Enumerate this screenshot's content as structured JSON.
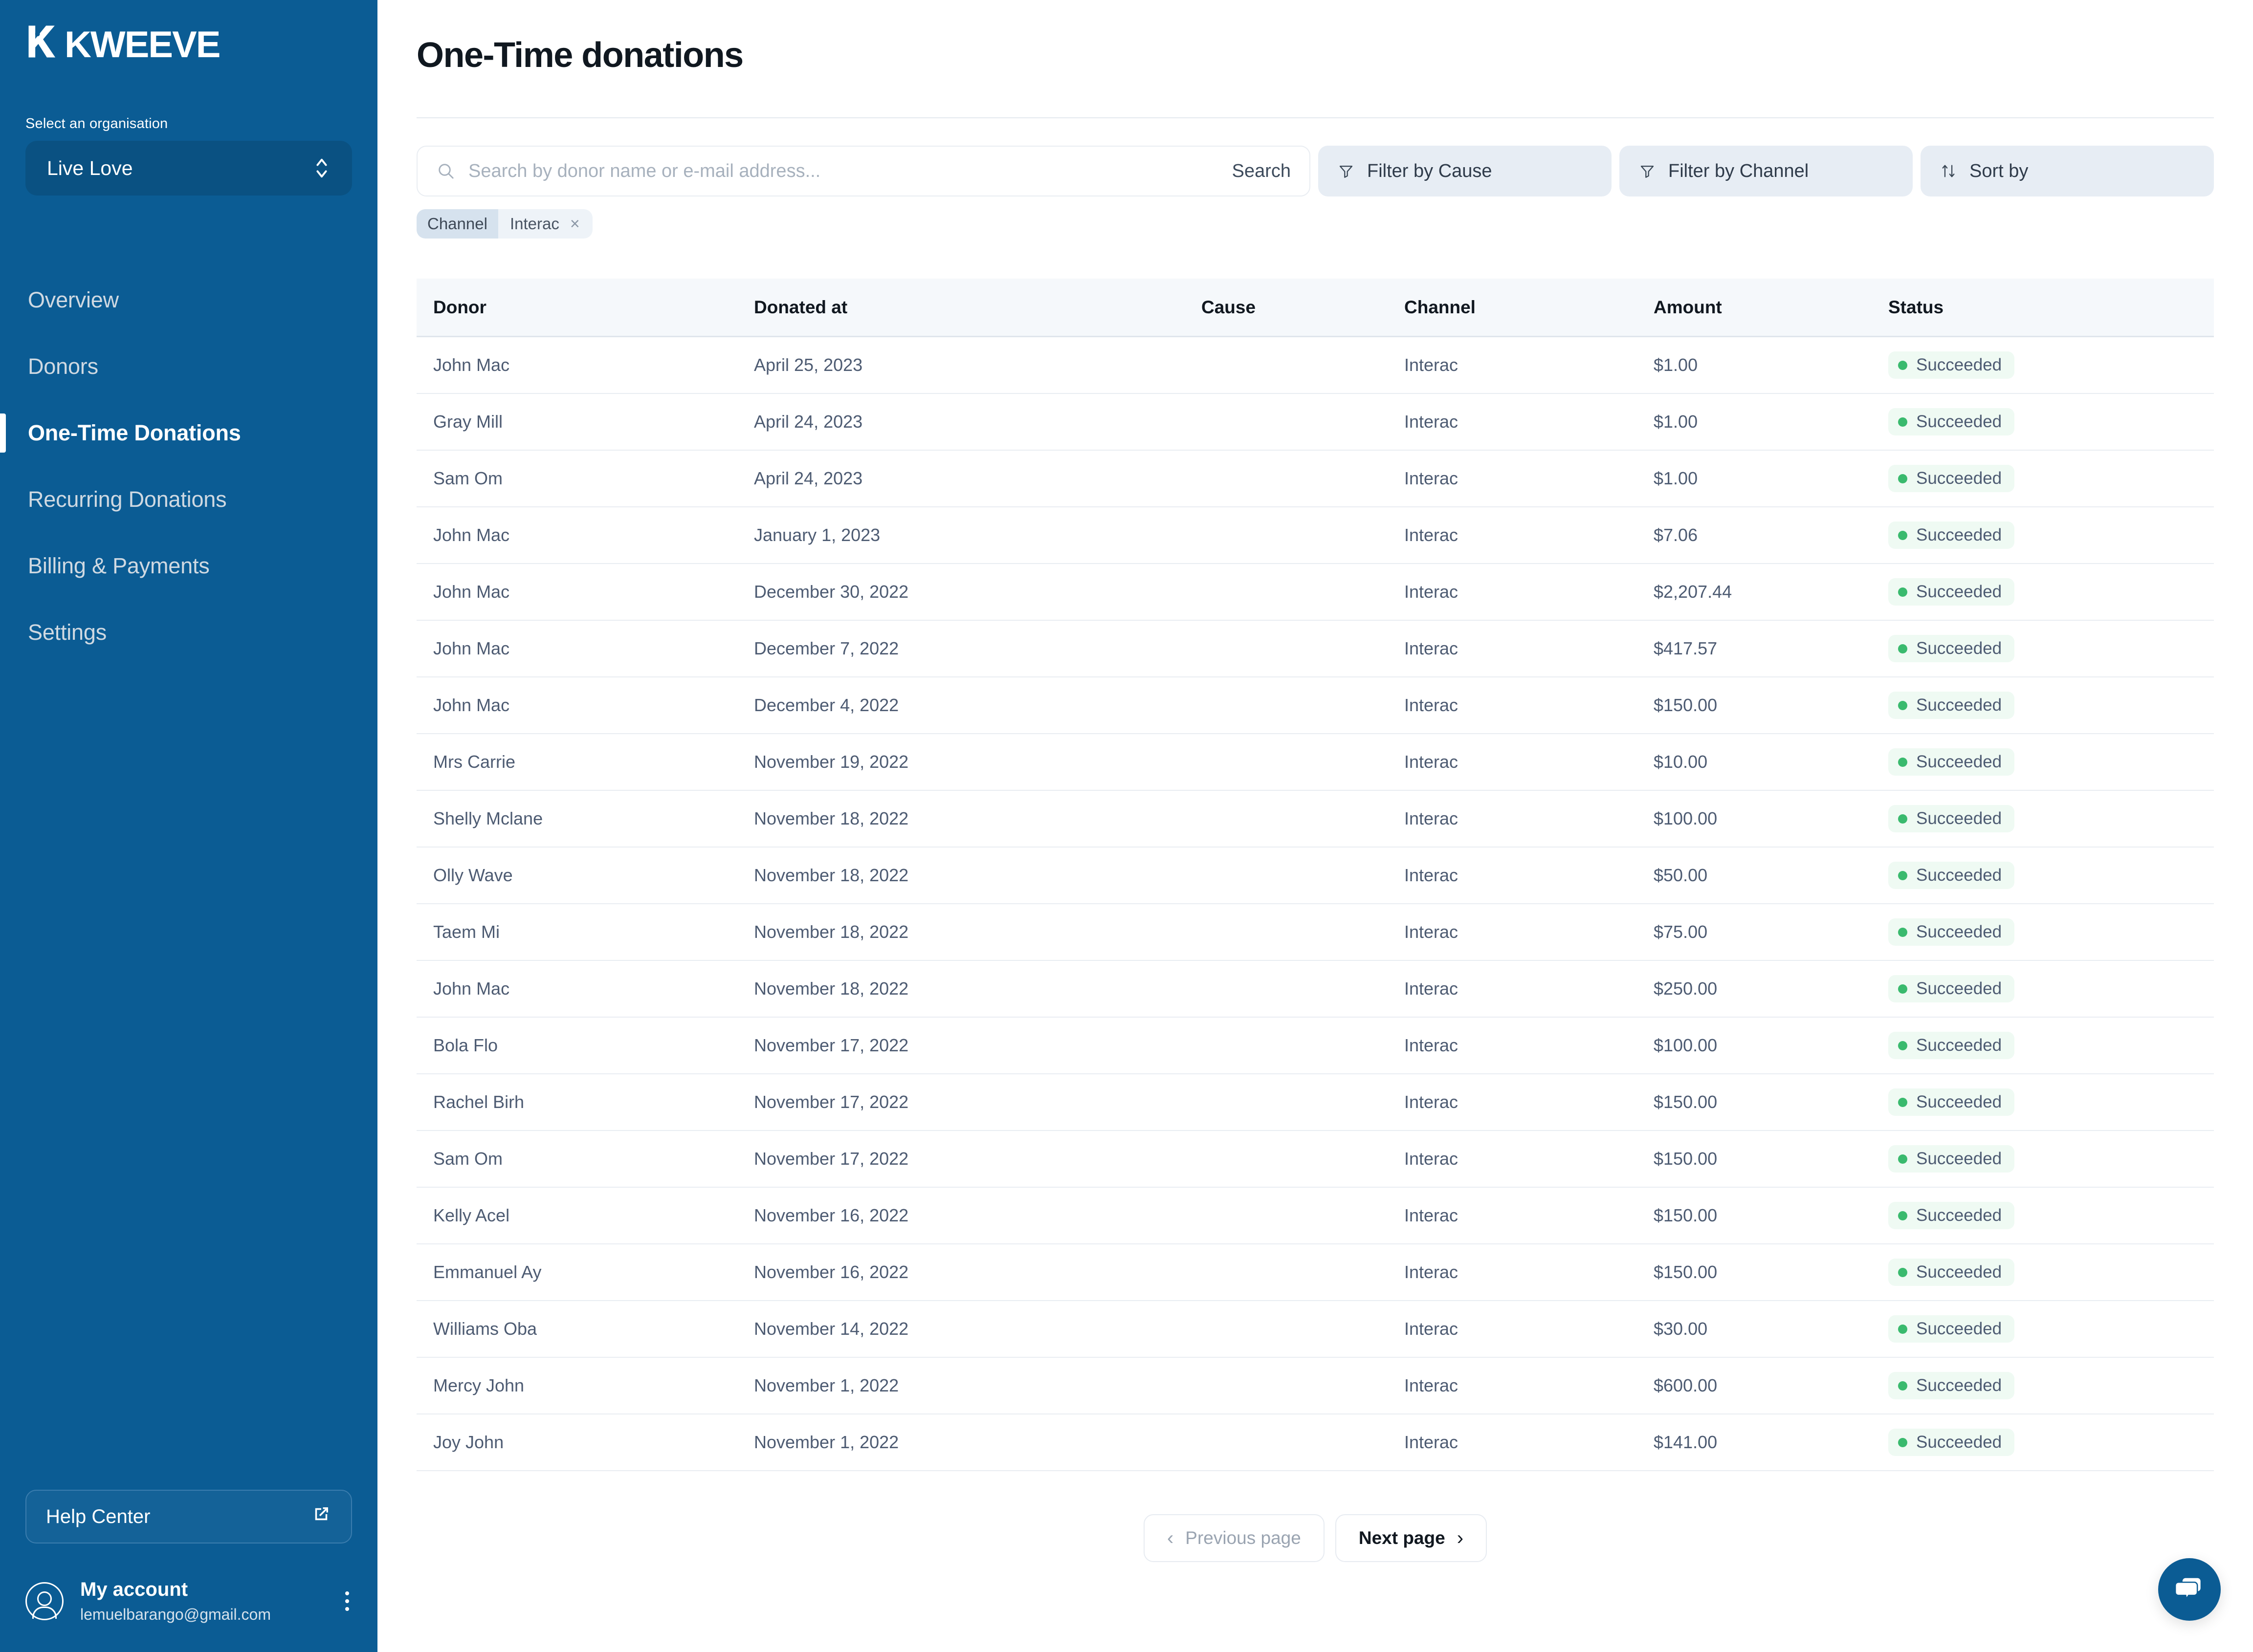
{
  "sidebar": {
    "logo": "KWEEVE",
    "org_label": "Select an organisation",
    "org_value": "Live Love",
    "nav": [
      {
        "label": "Overview"
      },
      {
        "label": "Donors"
      },
      {
        "label": "One-Time Donations"
      },
      {
        "label": "Recurring Donations"
      },
      {
        "label": "Billing & Payments"
      },
      {
        "label": "Settings"
      }
    ],
    "help_center": "Help Center",
    "account_name": "My account",
    "account_email": "lemuelbarango@gmail.com"
  },
  "header": {
    "title": "One-Time donations"
  },
  "toolbar": {
    "search_placeholder": "Search by donor name or e-mail address...",
    "search_value": "",
    "search_button": "Search",
    "filter_cause": "Filter by Cause",
    "filter_channel": "Filter by Channel",
    "sort_by": "Sort by"
  },
  "chips": [
    {
      "key": "Channel",
      "value": "Interac",
      "remove": "×"
    }
  ],
  "table": {
    "columns": [
      "Donor",
      "Donated at",
      "Cause",
      "Channel",
      "Amount",
      "Status"
    ],
    "rows": [
      {
        "donor": "John Mac",
        "date": "April 25, 2023",
        "cause": "",
        "channel": "Interac",
        "amount": "$1.00",
        "status": "Succeeded"
      },
      {
        "donor": "Gray Mill",
        "date": "April 24, 2023",
        "cause": "",
        "channel": "Interac",
        "amount": "$1.00",
        "status": "Succeeded"
      },
      {
        "donor": "Sam Om",
        "date": "April 24, 2023",
        "cause": "",
        "channel": "Interac",
        "amount": "$1.00",
        "status": "Succeeded"
      },
      {
        "donor": "John Mac",
        "date": "January 1, 2023",
        "cause": "",
        "channel": "Interac",
        "amount": "$7.06",
        "status": "Succeeded"
      },
      {
        "donor": "John Mac",
        "date": "December 30, 2022",
        "cause": "",
        "channel": "Interac",
        "amount": "$2,207.44",
        "status": "Succeeded"
      },
      {
        "donor": "John Mac",
        "date": "December 7, 2022",
        "cause": "",
        "channel": "Interac",
        "amount": "$417.57",
        "status": "Succeeded"
      },
      {
        "donor": "John Mac",
        "date": "December 4, 2022",
        "cause": "",
        "channel": "Interac",
        "amount": "$150.00",
        "status": "Succeeded"
      },
      {
        "donor": "Mrs Carrie",
        "date": "November 19, 2022",
        "cause": "",
        "channel": "Interac",
        "amount": "$10.00",
        "status": "Succeeded"
      },
      {
        "donor": "Shelly Mclane",
        "date": "November 18, 2022",
        "cause": "",
        "channel": "Interac",
        "amount": "$100.00",
        "status": "Succeeded"
      },
      {
        "donor": "Olly Wave",
        "date": "November 18, 2022",
        "cause": "",
        "channel": "Interac",
        "amount": "$50.00",
        "status": "Succeeded"
      },
      {
        "donor": "Taem Mi",
        "date": "November 18, 2022",
        "cause": "",
        "channel": "Interac",
        "amount": "$75.00",
        "status": "Succeeded"
      },
      {
        "donor": "John Mac",
        "date": "November 18, 2022",
        "cause": "",
        "channel": "Interac",
        "amount": "$250.00",
        "status": "Succeeded"
      },
      {
        "donor": "Bola Flo",
        "date": "November 17, 2022",
        "cause": "",
        "channel": "Interac",
        "amount": "$100.00",
        "status": "Succeeded"
      },
      {
        "donor": "Rachel Birh",
        "date": "November 17, 2022",
        "cause": "",
        "channel": "Interac",
        "amount": "$150.00",
        "status": "Succeeded"
      },
      {
        "donor": "Sam Om",
        "date": "November 17, 2022",
        "cause": "",
        "channel": "Interac",
        "amount": "$150.00",
        "status": "Succeeded"
      },
      {
        "donor": "Kelly Acel",
        "date": "November 16, 2022",
        "cause": "",
        "channel": "Interac",
        "amount": "$150.00",
        "status": "Succeeded"
      },
      {
        "donor": "Emmanuel Ay",
        "date": "November 16, 2022",
        "cause": "",
        "channel": "Interac",
        "amount": "$150.00",
        "status": "Succeeded"
      },
      {
        "donor": "Williams Oba",
        "date": "November 14, 2022",
        "cause": "",
        "channel": "Interac",
        "amount": "$30.00",
        "status": "Succeeded"
      },
      {
        "donor": "Mercy John",
        "date": "November 1, 2022",
        "cause": "",
        "channel": "Interac",
        "amount": "$600.00",
        "status": "Succeeded"
      },
      {
        "donor": "Joy John",
        "date": "November 1, 2022",
        "cause": "",
        "channel": "Interac",
        "amount": "$141.00",
        "status": "Succeeded"
      }
    ]
  },
  "pagination": {
    "previous": "Previous page",
    "next": "Next page"
  },
  "colors": {
    "sidebar_blue": "#0b5c94",
    "org_select_blue": "#0a5182",
    "status_green": "#3aba6e",
    "status_bg": "#effaf3",
    "filter_bg": "#e7edf4",
    "table_head_bg": "#f5f8fb"
  },
  "icons": {
    "search": "search-icon",
    "filter": "filter-icon",
    "sort": "sort-icon",
    "chat": "chat-icon"
  }
}
